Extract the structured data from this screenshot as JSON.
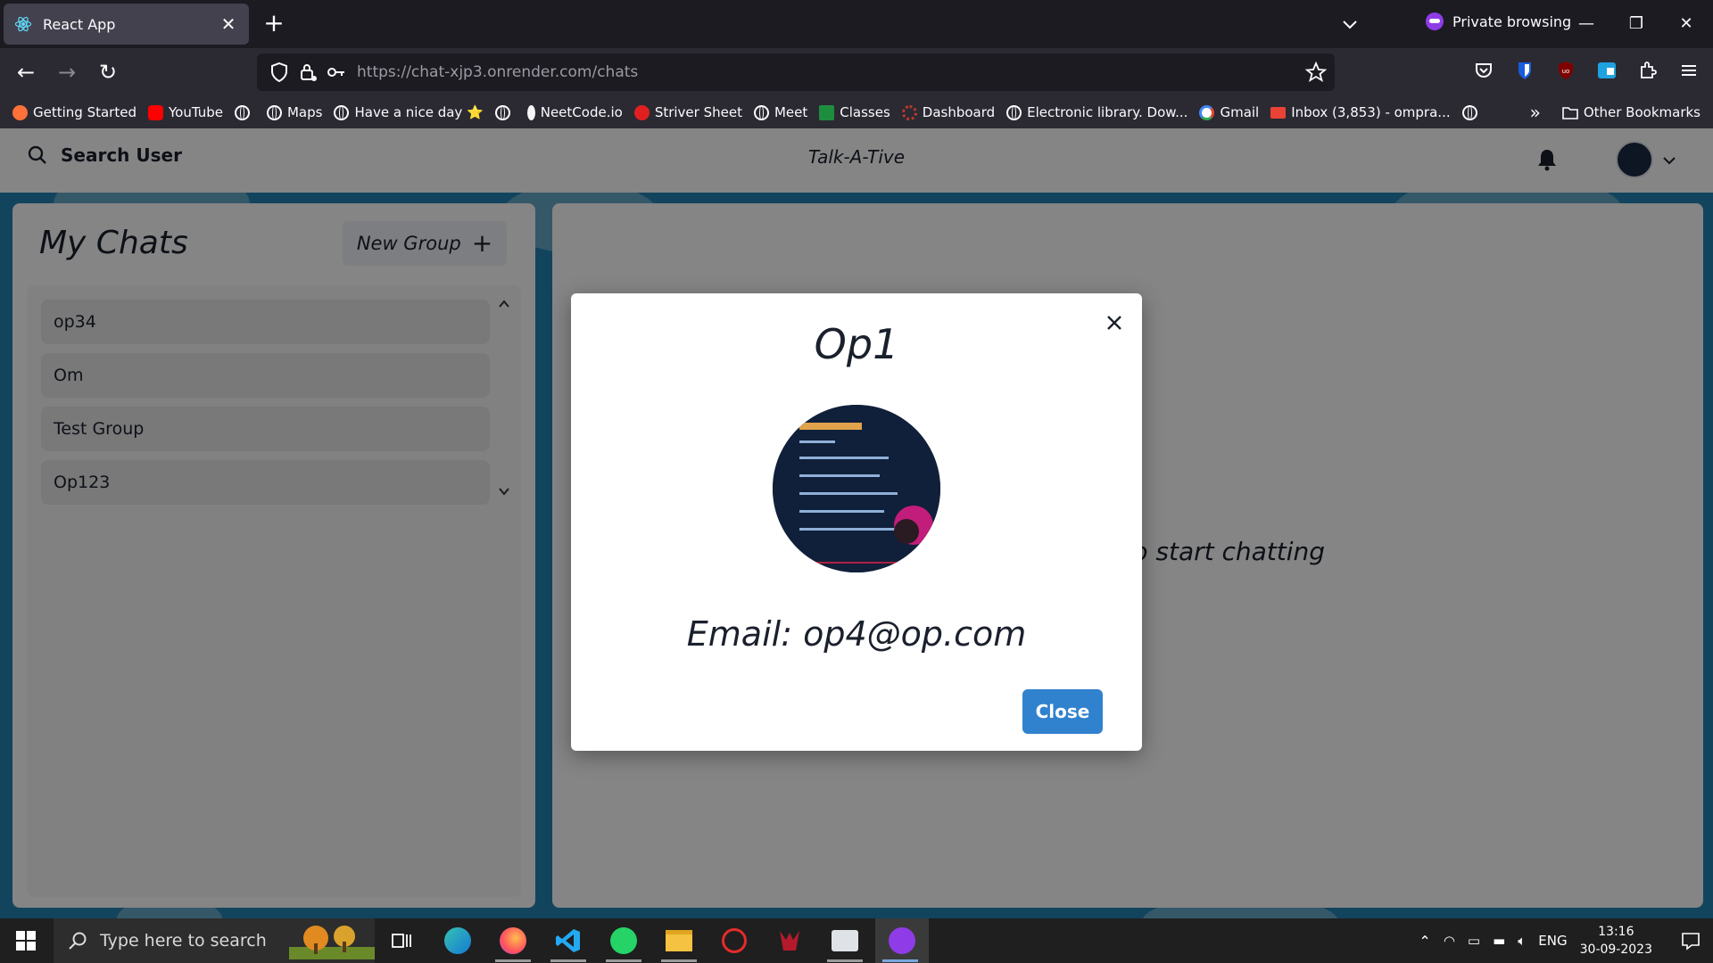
{
  "browser": {
    "tab_title": "React App",
    "private_label": "Private browsing",
    "url_host": "https://chat-xjp3.onrender.com",
    "url_path": "/chats"
  },
  "bookmarks": [
    {
      "label": "Getting Started",
      "icon": "firefox-icon",
      "color": "#ff7139"
    },
    {
      "label": "YouTube",
      "icon": "youtube-icon",
      "color": "#ff0000"
    },
    {
      "label": "",
      "icon": "globe-icon",
      "color": ""
    },
    {
      "label": "Maps",
      "icon": "globe-icon",
      "color": ""
    },
    {
      "label": "Have a nice day ⭐",
      "icon": "globe-icon",
      "color": ""
    },
    {
      "label": "",
      "icon": "globe-icon",
      "color": ""
    },
    {
      "label": "NeetCode.io",
      "icon": "rocket-icon",
      "color": "#f5f5f5"
    },
    {
      "label": "Striver Sheet",
      "icon": "tuf-icon",
      "color": "#e02020"
    },
    {
      "label": "Meet",
      "icon": "globe-icon",
      "color": ""
    },
    {
      "label": "Classes",
      "icon": "classroom-icon",
      "color": "#1e8e3e"
    },
    {
      "label": "Dashboard",
      "icon": "dashboard-icon",
      "color": "#c0392b"
    },
    {
      "label": "Electronic library. Dow...",
      "icon": "globe-icon",
      "color": ""
    },
    {
      "label": "Gmail",
      "icon": "google-icon",
      "color": "#4285f4"
    },
    {
      "label": "Inbox (3,853) - ompra...",
      "icon": "gmail-icon",
      "color": "#ea4335"
    },
    {
      "label": "",
      "icon": "globe-icon",
      "color": ""
    }
  ],
  "bookmarks_other": "Other Bookmarks",
  "app": {
    "search_label": "Search User",
    "brand": "Talk-A-Tive",
    "my_chats_title": "My Chats",
    "new_group_label": "New Group",
    "chats": [
      "op34",
      "Om",
      "Test Group",
      "Op123"
    ],
    "empty_hint": "Click on a user to start chatting"
  },
  "modal": {
    "name": "Op1",
    "email_text": "Email: op4@op.com",
    "close_label": "Close"
  },
  "taskbar": {
    "search_placeholder": "Type here to search",
    "language": "ENG",
    "time": "13:16",
    "date": "30-09-2023"
  },
  "colors": {
    "accent": "#3182ce",
    "page_bg": "#2383b4",
    "private": "#8f3ce8"
  }
}
